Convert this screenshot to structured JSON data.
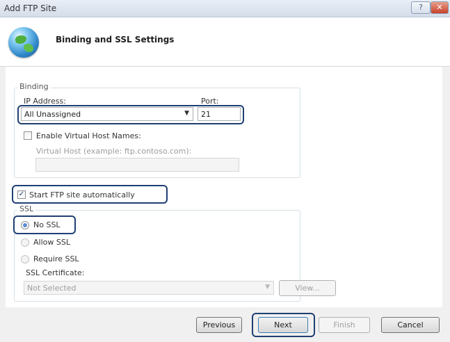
{
  "window": {
    "title": "Add FTP Site",
    "help_label": "?",
    "close_label": "✕"
  },
  "header": {
    "heading": "Binding and SSL Settings",
    "icon": "globe-icon"
  },
  "binding": {
    "legend": "Binding",
    "ip_label": "IP Address:",
    "ip_value": "All Unassigned",
    "port_label": "Port:",
    "port_value": "21",
    "virtual_host_names_label": "Enable Virtual Host Names:",
    "virtual_host_label": "Virtual Host (example: ftp.contoso.com):",
    "virtual_host_value": ""
  },
  "start_automatically_label": "Start FTP site automatically",
  "ssl": {
    "legend": "SSL",
    "no_ssl_label": "No SSL",
    "allow_ssl_label": "Allow SSL",
    "require_ssl_label": "Require SSL",
    "certificate_label": "SSL Certificate:",
    "certificate_value": "Not Selected",
    "view_label": "View..."
  },
  "buttons": {
    "previous": "Previous",
    "next": "Next",
    "finish": "Finish",
    "cancel": "Cancel"
  },
  "colors": {
    "highlight": "#1f3f73",
    "titlebar": "#dce4ee",
    "close": "#c8412b"
  }
}
